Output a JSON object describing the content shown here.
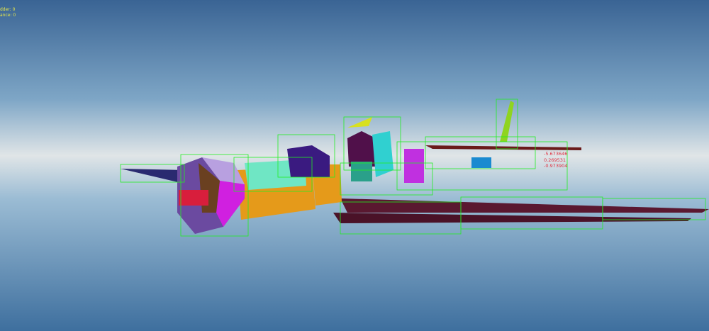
{
  "hud": {
    "lines": [
      "dder: 0",
      "ance: 0"
    ],
    "color": "#e8e84a"
  },
  "readout": {
    "values": [
      "-5.673646",
      "0.269531",
      "-0.973904"
    ],
    "color": "#e03040"
  },
  "scene": {
    "sky_top": "#3a6494",
    "horizon": "#dfe4e6",
    "ground_bottom": "#3e6f9e",
    "bounding_box_color": "#22ee22"
  }
}
